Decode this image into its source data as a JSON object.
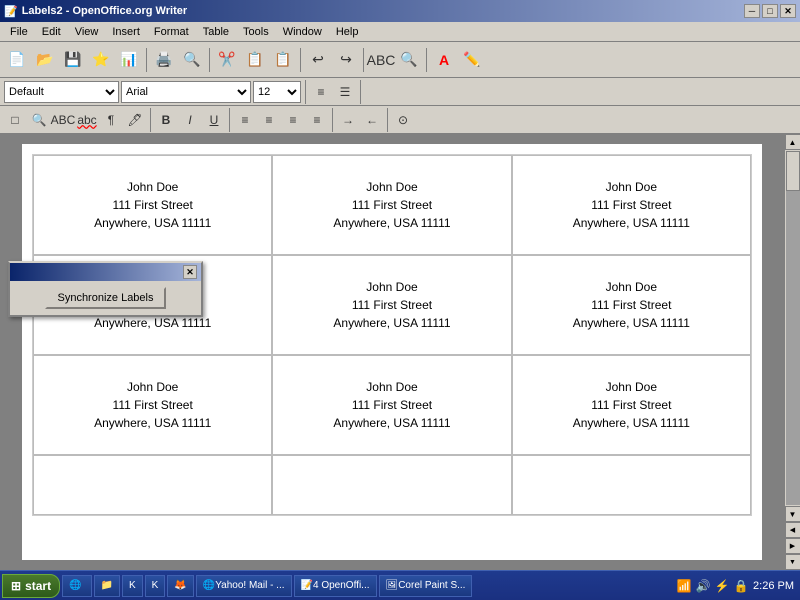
{
  "title_bar": {
    "title": "Labels2 - OpenOffice.org Writer",
    "min_btn": "─",
    "max_btn": "□",
    "close_btn": "✕"
  },
  "menu": {
    "items": [
      "File",
      "Edit",
      "View",
      "Insert",
      "Format",
      "Table",
      "Tools",
      "Window",
      "Help"
    ]
  },
  "toolbar": {
    "buttons": [
      "📄",
      "💾",
      "📁",
      "⭐",
      "💾",
      "📊",
      "✂️",
      "📋",
      "📋",
      "↩",
      "↪",
      "🔍",
      "🔤",
      "T",
      "✏️"
    ]
  },
  "format_toolbar": {
    "style": "Default",
    "font": "Arial",
    "size": "12",
    "bold": "B",
    "italic": "I",
    "underline": "U"
  },
  "sync_dialog": {
    "title": "",
    "btn_label": "Synchronize Labels"
  },
  "labels": {
    "name": "John Doe",
    "street": "111 First Street",
    "city": "Anywhere, USA 11111"
  },
  "taskbar": {
    "start": "start",
    "items": [
      "Yahoo! Mail - ...",
      "4 OpenOffi...",
      "Corel Paint S..."
    ],
    "time": "2:26 PM"
  }
}
